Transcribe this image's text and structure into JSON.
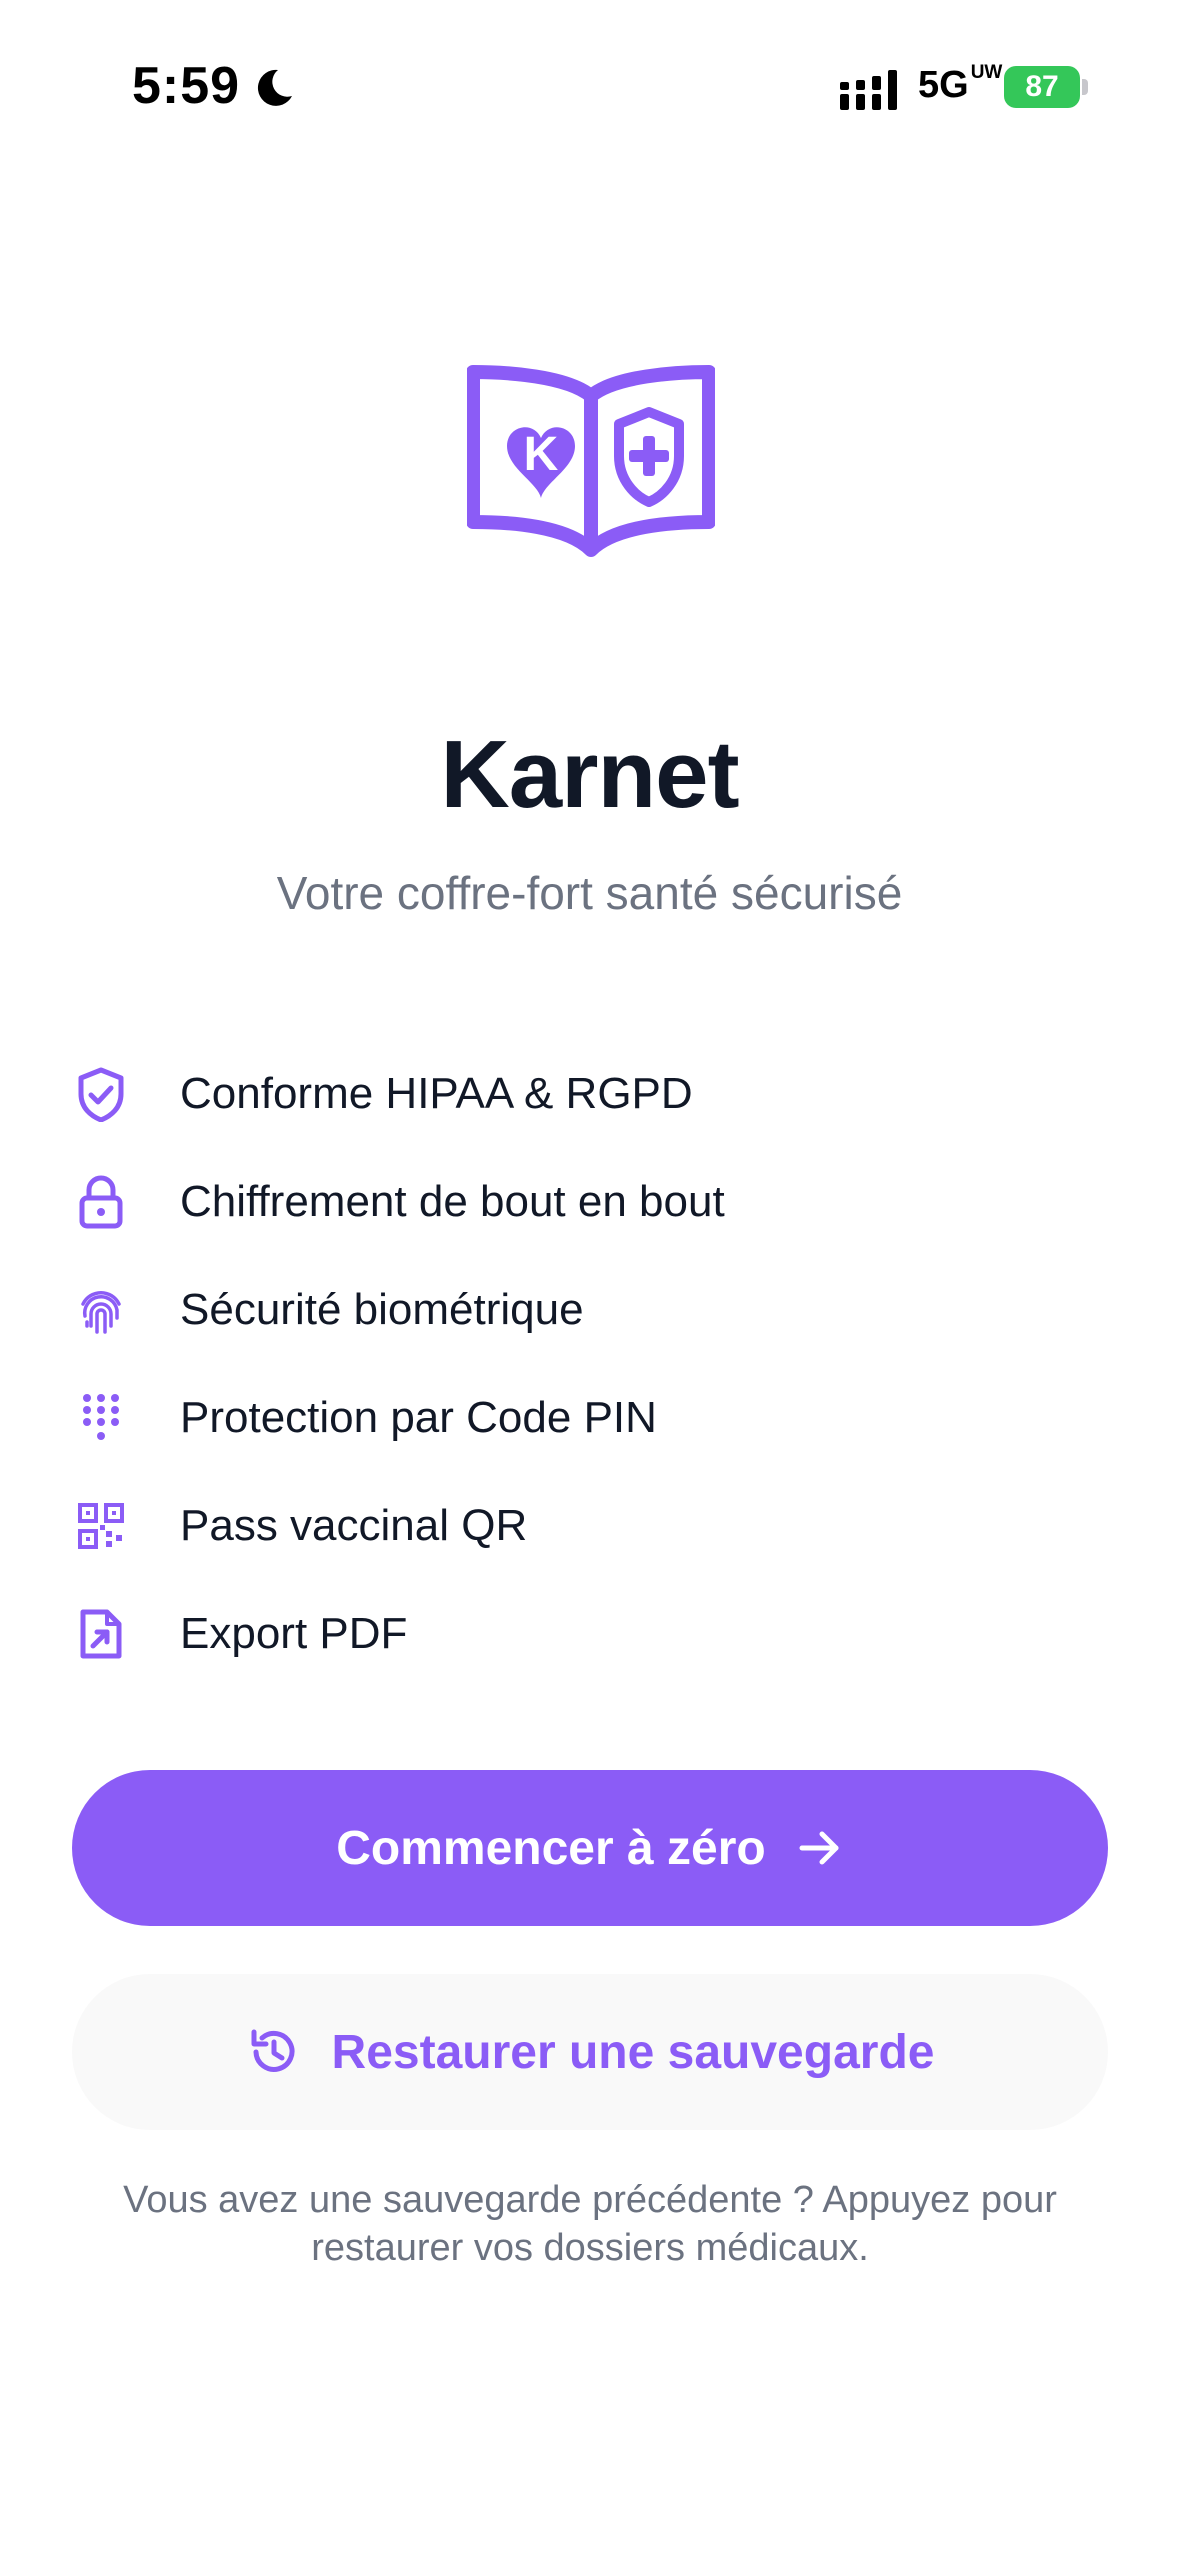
{
  "status_bar": {
    "time": "5:59",
    "network": "5G",
    "network_suffix": "UW",
    "battery": "87"
  },
  "app": {
    "name": "Karnet",
    "tagline": "Votre coffre-fort santé sécurisé",
    "accent_color": "#8b5cf6"
  },
  "features": [
    {
      "icon": "shield-check-icon",
      "label": "Conforme HIPAA & RGPD"
    },
    {
      "icon": "lock-icon",
      "label": "Chiffrement de bout en bout"
    },
    {
      "icon": "fingerprint-icon",
      "label": "Sécurité biométrique"
    },
    {
      "icon": "keypad-icon",
      "label": "Protection par Code PIN"
    },
    {
      "icon": "qr-code-icon",
      "label": "Pass vaccinal QR"
    },
    {
      "icon": "file-export-icon",
      "label": "Export PDF"
    }
  ],
  "actions": {
    "start_label": "Commencer à zéro",
    "restore_label": "Restaurer une sauvegarde"
  },
  "hint": "Vous avez une sauvegarde précédente ? Appuyez pour restaurer vos dossiers médicaux."
}
